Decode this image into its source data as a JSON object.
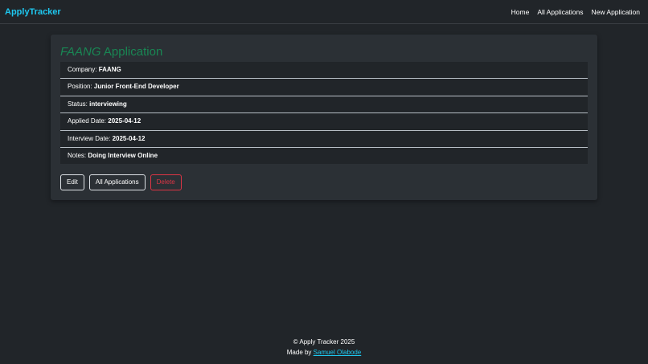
{
  "navbar": {
    "brand": "ApplyTracker",
    "links": [
      "Home",
      "All Applications",
      "New Application"
    ]
  },
  "card": {
    "title_company": "FAANG",
    "title_suffix": " Application",
    "details": [
      {
        "label": "Company: ",
        "value": "FAANG"
      },
      {
        "label": "Position: ",
        "value": "Junior Front-End Developer"
      },
      {
        "label": "Status: ",
        "value": "interviewing"
      },
      {
        "label": "Applied Date: ",
        "value": "2025-04-12"
      },
      {
        "label": "Interview Date: ",
        "value": "2025-04-12"
      },
      {
        "label": "Notes: ",
        "value": "Doing Interview Online"
      }
    ],
    "buttons": {
      "edit": "Edit",
      "all_applications": "All Applications",
      "delete": "Delete"
    }
  },
  "footer": {
    "copyright": "© Apply Tracker 2025",
    "made_by_prefix": "Made by ",
    "author": "Samuel Olabode"
  },
  "colors": {
    "background": "#212529",
    "brand": "#1ec8f0",
    "title_green": "#198754",
    "danger": "#dc3545"
  }
}
